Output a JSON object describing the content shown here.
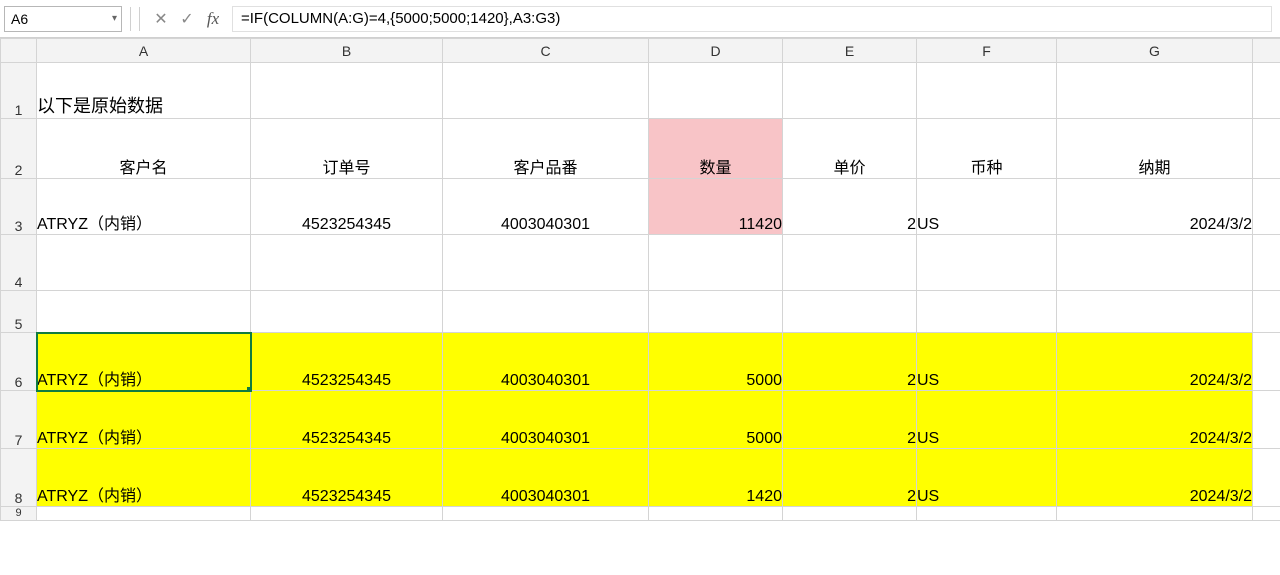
{
  "name_box": "A6",
  "formula": "=IF(COLUMN(A:G)=4,{5000;5000;1420},A3:G3)",
  "col_headers_index": {
    "A": "A",
    "B": "B",
    "C": "C",
    "D": "D",
    "E": "E",
    "F": "F",
    "G": "G"
  },
  "row_headers": {
    "r1": "1",
    "r2": "2",
    "r3": "3",
    "r4": "4",
    "r5": "5",
    "r6": "6",
    "r7": "7",
    "r8": "8",
    "r9": "9"
  },
  "row1": {
    "A": "以下是原始数据"
  },
  "row2": {
    "A": "客户名",
    "B": "订单号",
    "C": "客户品番",
    "D": "数量",
    "E": "单价",
    "F": "币种",
    "G": "纳期"
  },
  "row3": {
    "A": "ATRYZ（内销）",
    "B": "4523254345",
    "C": "4003040301",
    "D": "11420",
    "E": "2",
    "F": "US",
    "G": "2024/3/2"
  },
  "row6": {
    "A": "ATRYZ（内销）",
    "B": "4523254345",
    "C": "4003040301",
    "D": "5000",
    "E": "2",
    "F": "US",
    "G": "2024/3/2"
  },
  "row7": {
    "A": "ATRYZ（内销）",
    "B": "4523254345",
    "C": "4003040301",
    "D": "5000",
    "E": "2",
    "F": "US",
    "G": "2024/3/2"
  },
  "row8": {
    "A": "ATRYZ（内销）",
    "B": "4523254345",
    "C": "4003040301",
    "D": "1420",
    "E": "2",
    "F": "US",
    "G": "2024/3/2"
  },
  "chart_data": {
    "type": "table",
    "title": "以下是原始数据",
    "headers": [
      "客户名",
      "订单号",
      "客户品番",
      "数量",
      "单价",
      "币种",
      "纳期"
    ],
    "original_row": [
      "ATRYZ（内销）",
      "4523254345",
      "4003040301",
      11420,
      2,
      "US",
      "2024/3/2"
    ],
    "split_rows": [
      [
        "ATRYZ（内销）",
        "4523254345",
        "4003040301",
        5000,
        2,
        "US",
        "2024/3/2"
      ],
      [
        "ATRYZ（内销）",
        "4523254345",
        "4003040301",
        5000,
        2,
        "US",
        "2024/3/2"
      ],
      [
        "ATRYZ（内销）",
        "4523254345",
        "4003040301",
        1420,
        2,
        "US",
        "2024/3/2"
      ]
    ],
    "highlight": {
      "header_col": "数量",
      "original_value": 11420,
      "split_values": [
        5000,
        5000,
        1420
      ]
    }
  }
}
